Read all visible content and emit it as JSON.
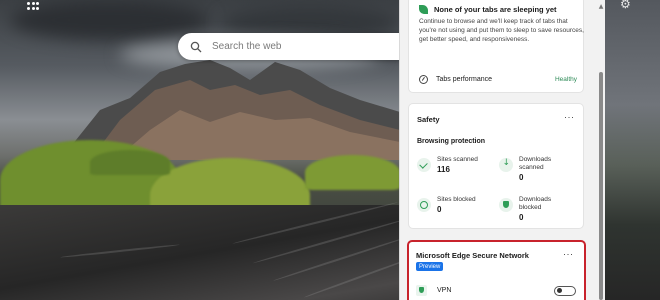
{
  "search": {
    "placeholder": "Search the web"
  },
  "tab_sleep": {
    "title": "None of your tabs are sleeping yet",
    "description": "Continue to browse and we'll keep track of tabs that you're not using and put them to sleep to save resources, get better speed, and responsiveness.",
    "performance_label": "Tabs performance",
    "performance_status": "Healthy"
  },
  "safety": {
    "title": "Safety",
    "more": "···",
    "subtitle": "Browsing protection",
    "stats": [
      {
        "label": "Sites scanned",
        "value": "116",
        "icon": "check-icon"
      },
      {
        "label": "Downloads scanned",
        "value": "0",
        "icon": "download-icon"
      },
      {
        "label": "Sites blocked",
        "value": "0",
        "icon": "block-icon"
      },
      {
        "label": "Downloads blocked",
        "value": "0",
        "icon": "shield-icon"
      }
    ]
  },
  "secure_network": {
    "title": "Microsoft Edge Secure Network",
    "badge": "Preview",
    "more": "···",
    "vpn_label": "VPN",
    "vpn_enabled": false
  },
  "colors": {
    "accent": "#1a73e8",
    "highlight_border": "#c8232c",
    "healthy": "#2e8b57"
  },
  "icons": [
    "apps-grid-icon",
    "gear-icon",
    "search-icon",
    "leaf-icon",
    "gauge-icon",
    "more-icon",
    "vpn-shield-icon"
  ]
}
